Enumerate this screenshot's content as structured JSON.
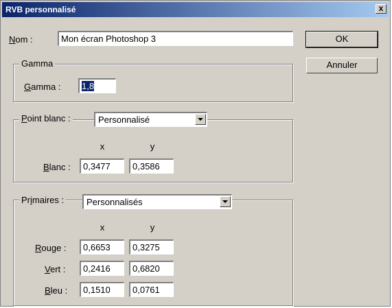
{
  "window": {
    "title": "RVB personnalisé",
    "close": "x"
  },
  "name_field": {
    "label_u": "N",
    "label_rest": "om :",
    "value": "Mon écran Photoshop 3"
  },
  "buttons": {
    "ok": "OK",
    "cancel": "Annuler"
  },
  "gamma": {
    "group_title": "Gamma",
    "label_u": "G",
    "label_rest": "amma :",
    "value": "1,8"
  },
  "white_point": {
    "label_u": "P",
    "label_rest": "oint blanc :",
    "selected": "Personnalisé",
    "col_x": "x",
    "col_y": "y",
    "row": {
      "label_u": "B",
      "label_rest": "lanc :",
      "x": "0,3477",
      "y": "0,3586"
    }
  },
  "primaries": {
    "label_pre": "Pr",
    "label_u": "i",
    "label_rest": "maires :",
    "selected": "Personnalisés",
    "col_x": "x",
    "col_y": "y",
    "rows": [
      {
        "label_u": "R",
        "label_rest": "ouge :",
        "x": "0,6653",
        "y": "0,3275"
      },
      {
        "label_u": "V",
        "label_rest": "ert :",
        "x": "0,2416",
        "y": "0,6820"
      },
      {
        "label_u": "B",
        "label_rest": "leu :",
        "x": "0,1510",
        "y": "0,0761"
      }
    ]
  }
}
